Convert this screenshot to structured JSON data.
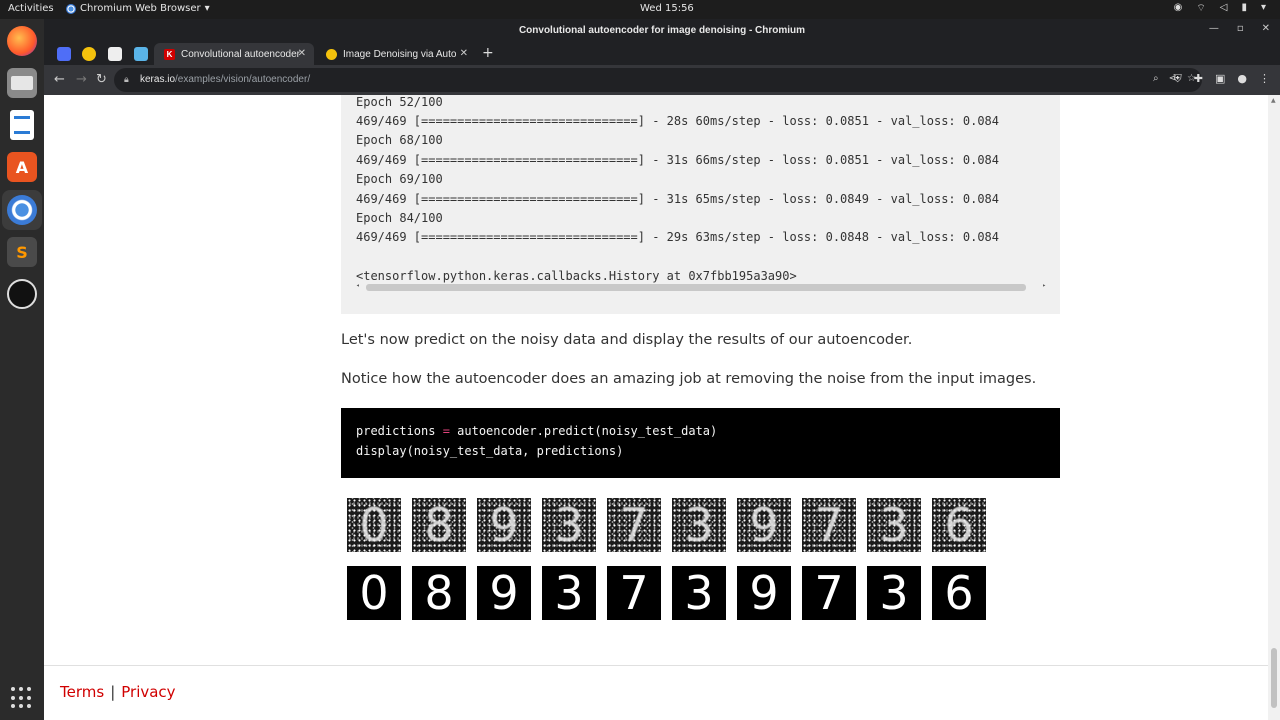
{
  "system_bar": {
    "activities": "Activities",
    "app_name": "Chromium Web Browser",
    "clock": "Wed 15:56"
  },
  "window": {
    "title": "Convolutional autoencoder for image denoising - Chromium"
  },
  "tabs": [
    {
      "label": "Convolutional autoencoder",
      "favicon": "K",
      "active": true
    },
    {
      "label": "Image Denoising via Auto",
      "favicon": "",
      "active": false
    }
  ],
  "address_bar": {
    "domain": "keras.io",
    "path": "/examples/vision/autoencoder/"
  },
  "output_block": {
    "lines": [
      "Epoch 52/100",
      "469/469 [==============================] - 28s 60ms/step - loss: 0.0851 - val_loss: 0.084",
      "Epoch 68/100",
      "469/469 [==============================] - 31s 66ms/step - loss: 0.0851 - val_loss: 0.084",
      "Epoch 69/100",
      "469/469 [==============================] - 31s 65ms/step - loss: 0.0849 - val_loss: 0.084",
      "Epoch 84/100",
      "469/469 [==============================] - 29s 63ms/step - loss: 0.0848 - val_loss: 0.084",
      "",
      "<tensorflow.python.keras.callbacks.History at 0x7fbb195a3a90>"
    ]
  },
  "paragraphs": {
    "p1": "Let's now predict on the noisy data and display the results of our autoencoder.",
    "p2": "Notice how the autoencoder does an amazing job at removing the noise from the input images."
  },
  "code_block": {
    "line1_var": "predictions ",
    "line1_op": "=",
    "line1_rest": " autoencoder.predict(noisy_test_data)",
    "line2": "display(noisy_test_data, predictions)"
  },
  "digits": {
    "noisy": [
      "0",
      "8",
      "9",
      "3",
      "7",
      "3",
      "9",
      "7",
      "3",
      "6"
    ],
    "denoised": [
      "0",
      "8",
      "9",
      "3",
      "7",
      "3",
      "9",
      "7",
      "3",
      "6"
    ]
  },
  "footer": {
    "terms": "Terms",
    "separator": "|",
    "privacy": "Privacy"
  }
}
